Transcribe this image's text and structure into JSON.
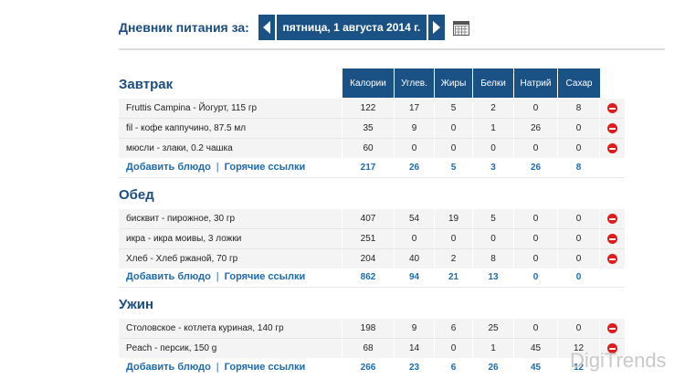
{
  "header": {
    "diary_label": "Дневник питания за:",
    "date": "пятница, 1 августа 2014 г."
  },
  "columns": [
    "Калории",
    "Углев.",
    "Жиры",
    "Белки",
    "Натрий",
    "Сахар"
  ],
  "meals": [
    {
      "title": "Завтрак",
      "items": [
        {
          "name": "Fruttis Campina - Йогурт, 115 гр",
          "values": [
            "122",
            "17",
            "5",
            "2",
            "0",
            "8"
          ]
        },
        {
          "name": "fil - кофе каппучино, 87.5 мл",
          "values": [
            "35",
            "9",
            "0",
            "1",
            "26",
            "0"
          ]
        },
        {
          "name": "мюсли - злаки, 0.2 чашка",
          "values": [
            "60",
            "0",
            "0",
            "0",
            "0",
            "0"
          ]
        }
      ],
      "add_label": "Добавить блюдо",
      "hotlinks_label": "Горячие ссылки",
      "totals": [
        "217",
        "26",
        "5",
        "3",
        "26",
        "8"
      ]
    },
    {
      "title": "Обед",
      "items": [
        {
          "name": "бисквит - пирожное, 30 гр",
          "values": [
            "407",
            "54",
            "19",
            "5",
            "0",
            "0"
          ]
        },
        {
          "name": "икра - икра моивы, 3 ложки",
          "values": [
            "251",
            "0",
            "0",
            "0",
            "0",
            "0"
          ]
        },
        {
          "name": "Хлеб - Хлеб ржаной, 70 гр",
          "values": [
            "204",
            "40",
            "2",
            "8",
            "0",
            "0"
          ]
        }
      ],
      "add_label": "Добавить блюдо",
      "hotlinks_label": "Горячие ссылки",
      "totals": [
        "862",
        "94",
        "21",
        "13",
        "0",
        "0"
      ]
    },
    {
      "title": "Ужин",
      "items": [
        {
          "name": "Столовское - котлета куриная, 140 гр",
          "values": [
            "198",
            "9",
            "6",
            "25",
            "0",
            "0"
          ]
        },
        {
          "name": "Peach - персик, 150 g",
          "values": [
            "68",
            "14",
            "0",
            "1",
            "45",
            "12"
          ]
        }
      ],
      "add_label": "Добавить блюдо",
      "hotlinks_label": "Горячие ссылки",
      "totals": [
        "266",
        "23",
        "6",
        "26",
        "45",
        "12"
      ]
    }
  ],
  "icons": {
    "prev": "chevron-left-icon",
    "next": "chevron-right-icon",
    "calendar": "calendar-icon",
    "delete": "delete-icon"
  },
  "colors": {
    "accent": "#1b5286",
    "link": "#1b6bb0",
    "delete": "#e01b1b"
  },
  "watermark": "DigiTrends"
}
